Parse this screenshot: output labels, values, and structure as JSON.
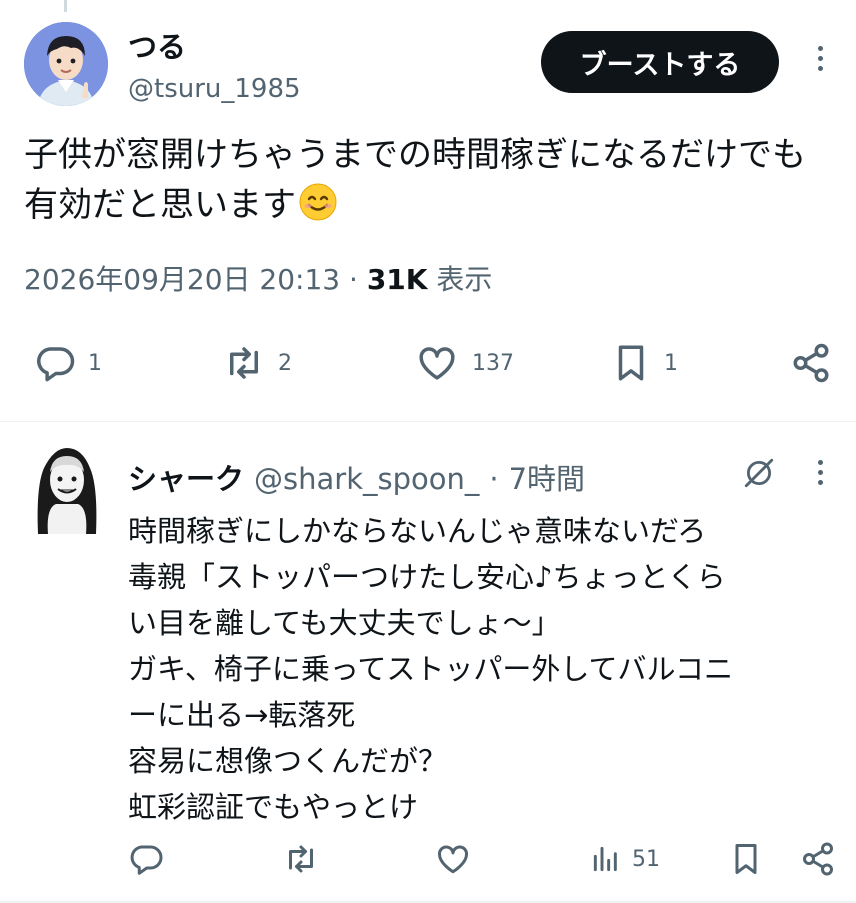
{
  "post": {
    "display_name": "つる",
    "handle": "@tsuru_1985",
    "boost_label": "ブーストする",
    "text": "子供が窓開けちゃうまでの時間稼ぎになるだけでも有効だと思います",
    "emoji": "smiling-face-emoji",
    "timestamp": "2026年09月20日 20:13",
    "meta_separator": "·",
    "views_count": "31K",
    "views_label": "表示",
    "actions": {
      "reply_count": "1",
      "repost_count": "2",
      "like_count": "137",
      "bookmark_count": "1"
    }
  },
  "reply": {
    "display_name": "シャーク",
    "handle": "@shark_spoon_",
    "separator": "·",
    "time": "7時間",
    "lines": [
      "時間稼ぎにしかならないんじゃ意味ないだろ",
      "毒親「ストッパーつけたし安心♪ちょっとくら",
      "い目を離しても大丈夫でしょ～」",
      "ガキ、椅子に乗ってストッパー外してバルコニ",
      "ーに出る→転落死",
      "容易に想像つくんだが？",
      "虹彩認証でもやっとけ"
    ],
    "actions": {
      "views_count": "51"
    }
  },
  "colors": {
    "text": "#0f1419",
    "secondary": "#536471",
    "button_bg": "#0f1419",
    "divider": "#eff3f4"
  }
}
